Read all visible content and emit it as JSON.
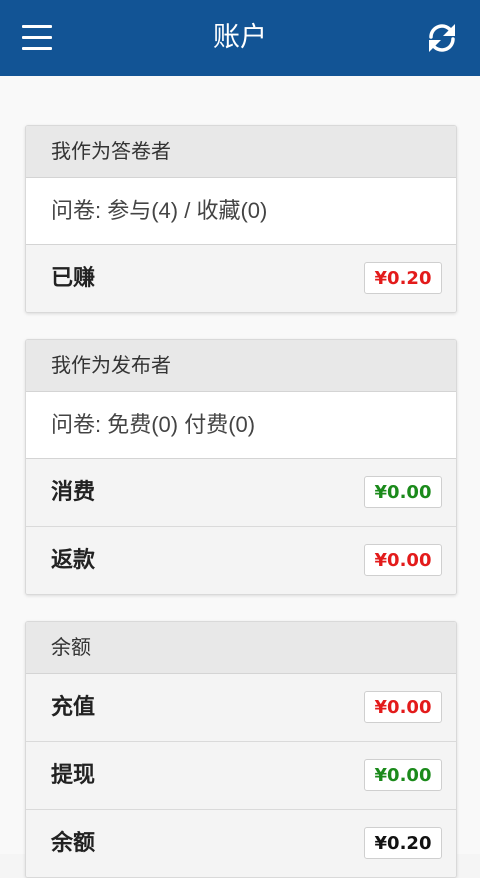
{
  "header": {
    "title": "账户",
    "background": "#125495"
  },
  "sections": [
    {
      "header": "我作为答卷者",
      "info": "问卷: 参与(4) / 收藏(0)",
      "rows": [
        {
          "label": "已赚",
          "amount": "¥0.20",
          "color": "#e31b1b"
        }
      ]
    },
    {
      "header": "我作为发布者",
      "info": "问卷: 免费(0) 付费(0)",
      "rows": [
        {
          "label": "消费",
          "amount": "¥0.00",
          "color": "#1b8a1b"
        },
        {
          "label": "返款",
          "amount": "¥0.00",
          "color": "#e31b1b"
        }
      ]
    },
    {
      "header": "余额",
      "rows": [
        {
          "label": "充值",
          "amount": "¥0.00",
          "color": "#e31b1b"
        },
        {
          "label": "提现",
          "amount": "¥0.00",
          "color": "#1b8a1b"
        },
        {
          "label": "余额",
          "amount": "¥0.20",
          "color": "#111111"
        }
      ]
    }
  ]
}
